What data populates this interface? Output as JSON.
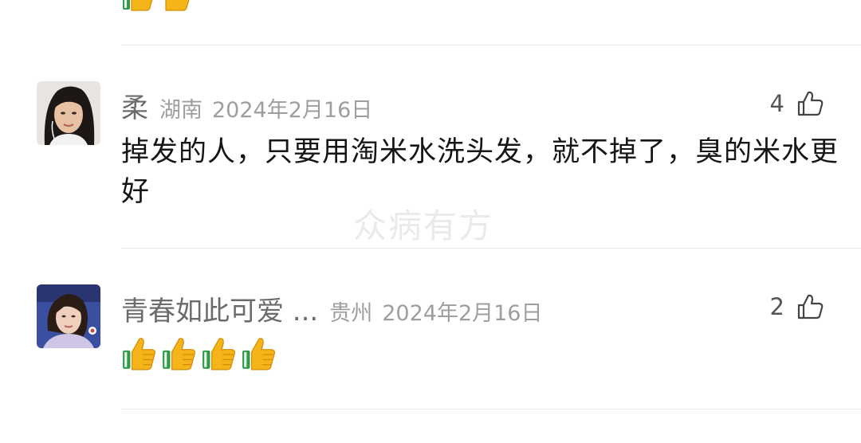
{
  "watermark": "众病有方",
  "comments": [
    {
      "username": "柔",
      "location": "湖南",
      "date": "2024年2月16日",
      "likes": "4",
      "content": "掉发的人，只要用淘米水洗头发，就不掉了，臭的米水更好",
      "avatar_icon": "user-avatar-photo"
    },
    {
      "username": "青春如此可爱 ...",
      "location": "贵州",
      "date": "2024年2月16日",
      "likes": "2",
      "content_emojis": [
        "thumbs-up",
        "thumbs-up",
        "thumbs-up",
        "thumbs-up"
      ],
      "avatar_icon": "user-avatar-photo"
    }
  ],
  "colors": {
    "username": "#6b6b6b",
    "meta": "#9e9e9e",
    "divider": "#e6e6e6",
    "thumb_yellow": "#f5b417",
    "thumb_green": "#2e9b4a"
  }
}
